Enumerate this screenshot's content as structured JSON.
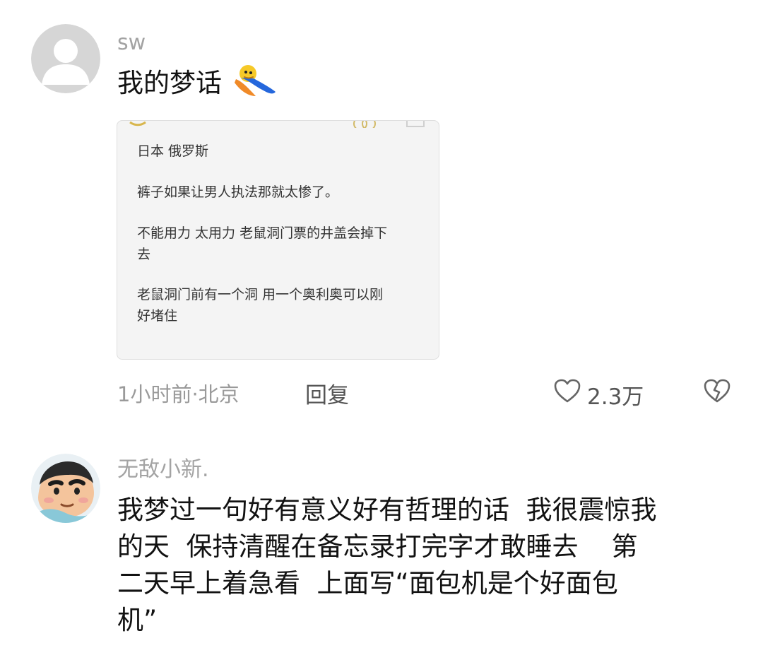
{
  "comments": [
    {
      "username": "sw",
      "text": "我的梦话",
      "memo": {
        "lines": [
          "日本 俄罗斯",
          "裤子如果让男人执法那就太惨了。",
          "不能用力 太用力 老鼠洞门票的井盖会掉下\n去",
          "老鼠洞门前有一个洞 用一个奥利奥可以刚\n好堵住"
        ]
      },
      "meta": {
        "time_location": "1小时前·北京",
        "reply_label": "回复",
        "like_count": "2.3万"
      }
    },
    {
      "username": "无敌小新.",
      "text": "我梦过一句好有意义好有哲理的话  我很震惊我\n的天  保持清醒在备忘录打完字才敢睡去    第\n二天早上着急看  上面写“面包机是个好面包\n机”"
    }
  ],
  "colors": {
    "username": "#a3a3a3",
    "body_text": "#121212",
    "meta_text": "#9a9a9a",
    "memo_bg": "#f4f4f4",
    "default_avatar": "#d2d2d2"
  },
  "icons": [
    "default-avatar-icon",
    "sleeping-emoji-icon",
    "heart-outline-icon",
    "broken-heart-icon",
    "crayon-shin-chan-avatar"
  ]
}
